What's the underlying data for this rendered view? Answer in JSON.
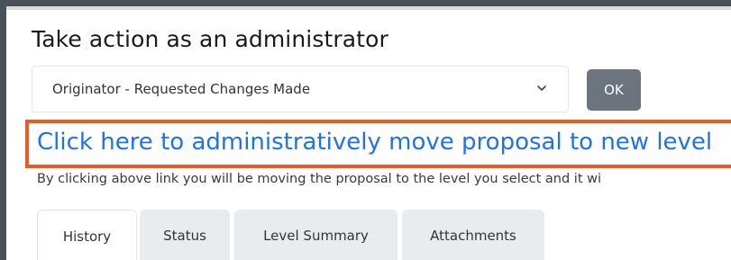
{
  "panel": {
    "title": "Take action as an administrator"
  },
  "action_select": {
    "selected": "Originator - Requested Changes Made"
  },
  "ok_button": {
    "label": "OK"
  },
  "admin_link": {
    "text": "Click here to administratively move proposal to new level"
  },
  "note": {
    "text": "By clicking above link you will be moving the proposal to the level you select and it wi"
  },
  "tabs": [
    {
      "label": "History",
      "active": true
    },
    {
      "label": "Status",
      "active": false
    },
    {
      "label": "Level Summary",
      "active": false
    },
    {
      "label": "Attachments",
      "active": false
    }
  ],
  "colors": {
    "link": "#1f73e6",
    "highlight": "#f05a22",
    "button": "#6c757d",
    "frame": "#4a5158"
  },
  "icons": {
    "dropdown": "chevron-down-icon"
  }
}
